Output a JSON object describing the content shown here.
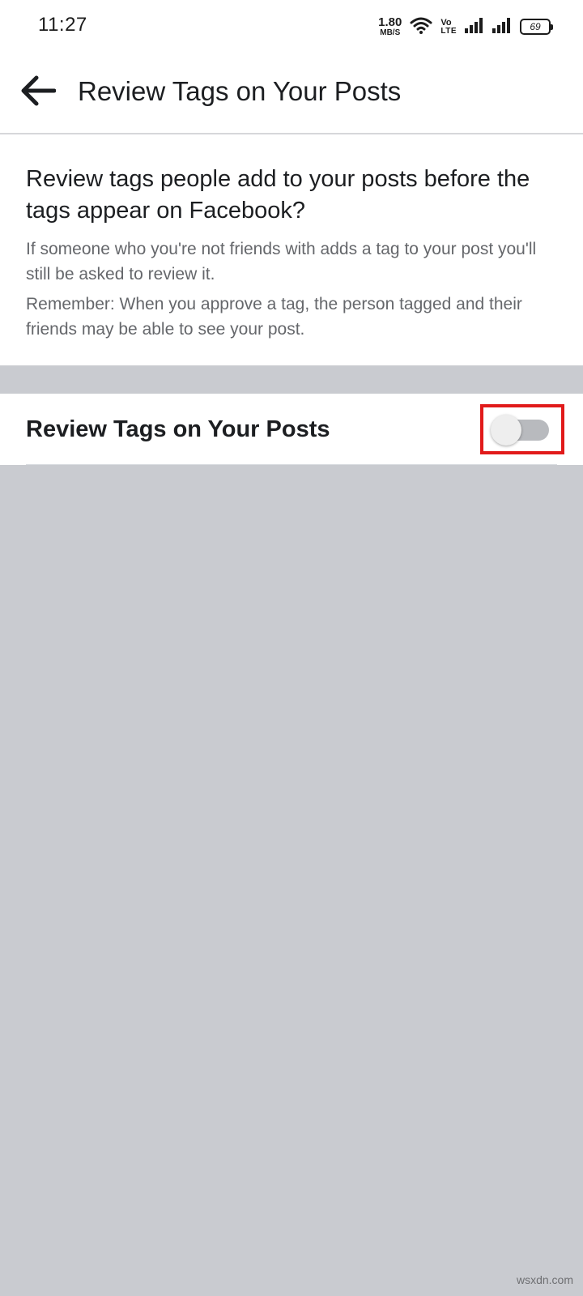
{
  "status_bar": {
    "time": "11:27",
    "net_speed_value": "1.80",
    "net_speed_unit": "MB/S",
    "volte_top": "Vo",
    "volte_bottom": "LTE",
    "battery_level": "69"
  },
  "header": {
    "title": "Review Tags on Your Posts"
  },
  "info": {
    "question": "Review tags people add to your posts before the tags appear on Facebook?",
    "note_1": "If someone who you're not friends with adds a tag to your post you'll still be asked to review it.",
    "note_2": "Remember: When you approve a tag, the person tagged and their friends may be able to see your post."
  },
  "setting": {
    "label": "Review Tags on Your Posts",
    "enabled": false
  },
  "watermark": "wsxdn.com",
  "colors": {
    "highlight": "#e11a1a",
    "switch_track_off": "#b8babe",
    "page_background": "#c9cbd0"
  }
}
